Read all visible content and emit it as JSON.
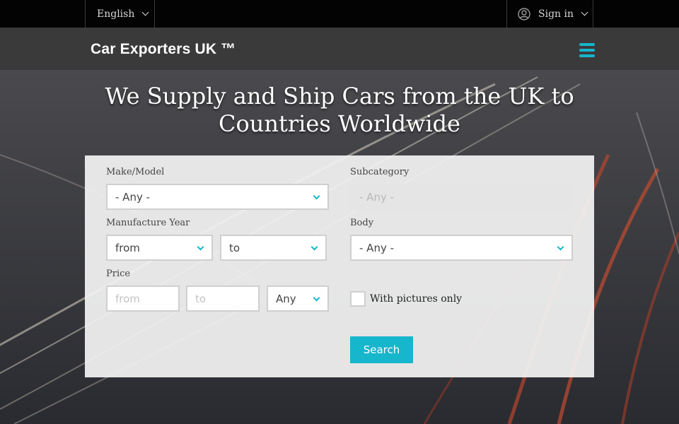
{
  "topbar": {
    "language": "English",
    "signin": "Sign in"
  },
  "header": {
    "brand": "Car Exporters UK ™"
  },
  "hero": {
    "title": "We Supply and Ship Cars from the UK to Countries Worldwide"
  },
  "search_form": {
    "make_model": {
      "label": "Make/Model",
      "value": "- Any -"
    },
    "subcategory": {
      "label": "Subcategory",
      "value": "- Any -"
    },
    "manufacture_year": {
      "label": "Manufacture Year",
      "from": "from",
      "to": "to"
    },
    "body": {
      "label": "Body",
      "value": "- Any -"
    },
    "price": {
      "label": "Price",
      "from_placeholder": "from",
      "to_placeholder": "to",
      "currency": "Any"
    },
    "with_pictures": {
      "label": "With pictures only",
      "checked": false
    },
    "search_button": "Search"
  },
  "colors": {
    "accent": "#16b6cc",
    "topbar": "#030303",
    "header": "#3a3a3a"
  }
}
